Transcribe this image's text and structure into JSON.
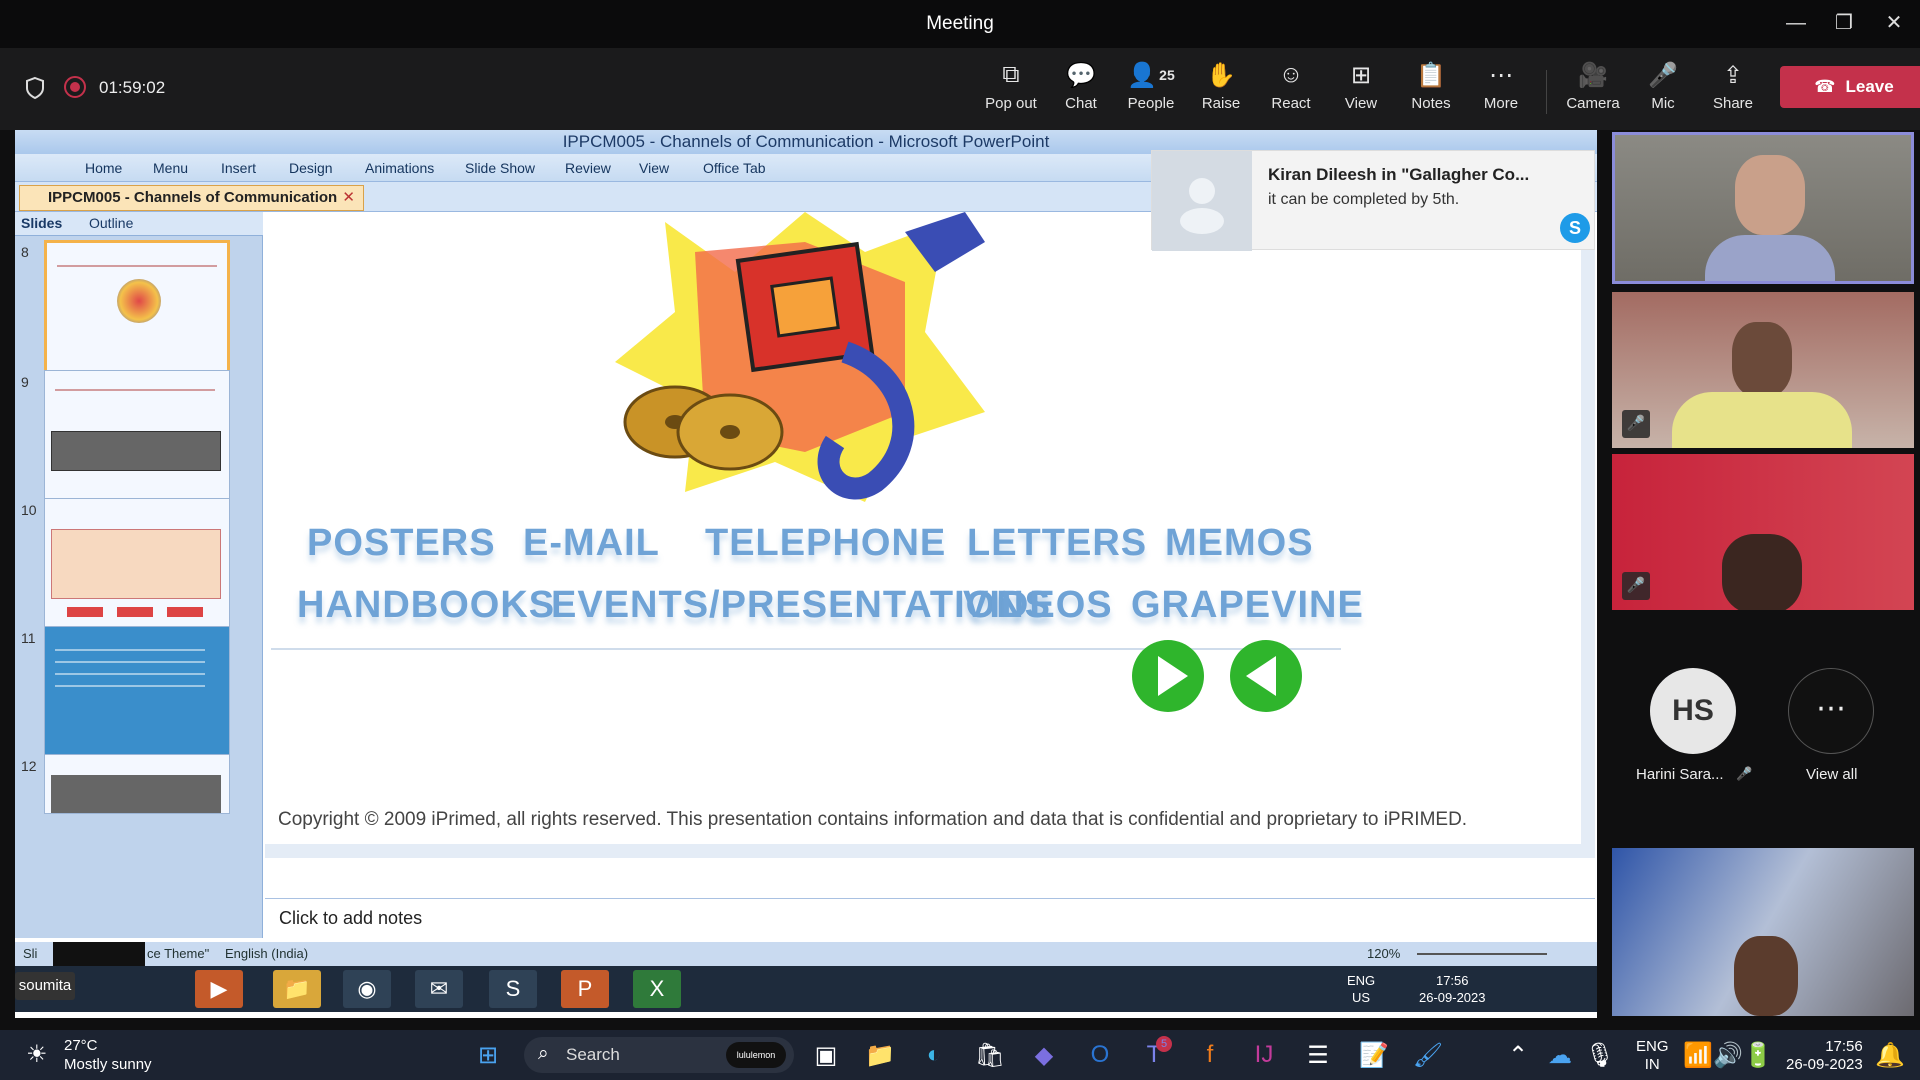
{
  "window": {
    "title": "Meeting"
  },
  "meeting": {
    "timer": "01:59:02",
    "people_count": "25",
    "leave_label": "Leave",
    "toolbar": [
      {
        "label": "Pop out",
        "icon": "pop-out-icon"
      },
      {
        "label": "Chat",
        "icon": "chat-icon"
      },
      {
        "label": "People",
        "icon": "people-icon"
      },
      {
        "label": "Raise",
        "icon": "raise-hand-icon"
      },
      {
        "label": "React",
        "icon": "react-icon"
      },
      {
        "label": "View",
        "icon": "view-icon"
      },
      {
        "label": "Notes",
        "icon": "notes-icon"
      },
      {
        "label": "More",
        "icon": "more-icon"
      }
    ],
    "media": [
      {
        "label": "Camera",
        "icon": "camera-icon"
      },
      {
        "label": "Mic",
        "icon": "mic-off-icon"
      },
      {
        "label": "Share",
        "icon": "share-icon"
      }
    ]
  },
  "ppt": {
    "title": "IPPCM005 - Channels of Communication - Microsoft PowerPoint",
    "tabs": [
      "Home",
      "Menu",
      "Insert",
      "Design",
      "Animations",
      "Slide Show",
      "Review",
      "View",
      "Office Tab"
    ],
    "doc_tab": "IPPCM005 - Channels of Communication",
    "pane_tabs": [
      "Slides",
      "Outline"
    ],
    "slide_numbers": [
      "8",
      "9",
      "10",
      "11",
      "12"
    ],
    "slide_words": {
      "row1": [
        "POSTERS",
        "E-MAIL",
        "TELEPHONE",
        "LETTERS",
        "MEMOS"
      ],
      "row2": [
        "HANDBOOKS",
        "EVENTS/PRESENTATIONS",
        "VIDEOS",
        "GRAPEVINE"
      ]
    },
    "copyright": "Copyright © 2009 iPrimed, all rights reserved. This presentation contains information  and data  that is confidential and proprietary to iPRIMED.",
    "notes_placeholder": "Click to add notes",
    "status_theme": "ce Theme\"",
    "status_lang": "English (India)",
    "zoom": "120%",
    "inner_clock_lang": "ENG",
    "inner_clock_region": "US",
    "inner_time": "17:56",
    "inner_date": "26-09-2023",
    "presenter_name": "soumita"
  },
  "toast": {
    "title": "Kiran Dileesh in \"Gallagher Co...",
    "body": "it can be completed by 5th."
  },
  "participants": {
    "initials": "HS",
    "name": "Harini Sara...",
    "view_all": "View all"
  },
  "taskbar": {
    "weather_temp": "27°C",
    "weather_desc": "Mostly sunny",
    "search": "Search",
    "badge": "lululemon",
    "teams_badge": "5",
    "lang": "ENG",
    "region": "IN",
    "time": "17:56",
    "date": "26-09-2023"
  },
  "colors": {
    "leave": "#c4314b",
    "slide_text": "#6fa3d6",
    "accent": "#6264a7"
  }
}
